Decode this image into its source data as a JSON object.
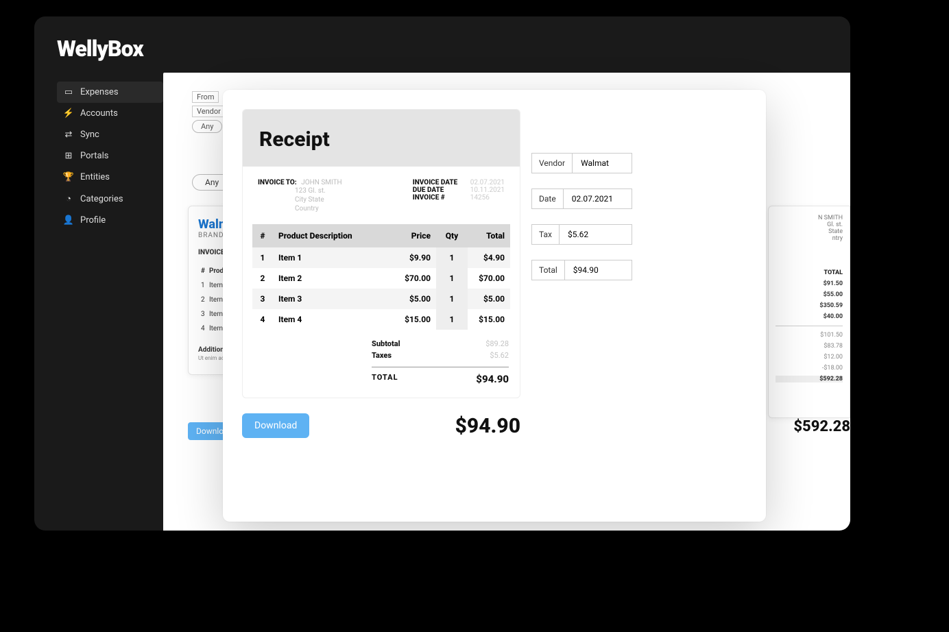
{
  "brand": "WellyBox",
  "sidebar": {
    "items": [
      {
        "label": "Expenses",
        "icon": "receipt-icon"
      },
      {
        "label": "Accounts",
        "icon": "plug-icon"
      },
      {
        "label": "Sync",
        "icon": "arrows-icon"
      },
      {
        "label": "Portals",
        "icon": "sitemap-icon"
      },
      {
        "label": "Entities",
        "icon": "trophy-icon"
      },
      {
        "label": "Categories",
        "icon": "pie-icon"
      },
      {
        "label": "Profile",
        "icon": "user-icon"
      }
    ],
    "active": 0
  },
  "filters": {
    "from_label": "From",
    "vendor_label": "Vendor",
    "any_chip": "Any"
  },
  "bg_left": {
    "brand": "Walm",
    "tag": "BRANDIN",
    "inv_to": "INVOICE TO",
    "hash": "#",
    "prod": "Prod",
    "rows": [
      {
        "n": "1",
        "v": "Item"
      },
      {
        "n": "2",
        "v": "Item"
      },
      {
        "n": "3",
        "v": "Item"
      },
      {
        "n": "4",
        "v": "Item"
      }
    ],
    "addl": "Additional",
    "lorem": "Ut enim ad mi ullamco labori consequat.",
    "download": "Download"
  },
  "bg_right": {
    "name": "N SMITH",
    "addr1": "Gl. st.",
    "addr2": "State",
    "addr3": "ntry",
    "total_label": "TOTAL",
    "values": [
      "$91.50",
      "$55.00",
      "$350.59",
      "$40.00"
    ],
    "subvalues": [
      "$101.50",
      "$83.78",
      "$12.00",
      "-$18.00"
    ],
    "grand": "$592.28",
    "big_total": "$592.28"
  },
  "receipt": {
    "title": "Receipt",
    "invoice_to_label": "INVOICE TO:",
    "invoice_to_name": "JOHN SMITH",
    "addr1": "123 Gl. st.",
    "addr2": "City    State",
    "addr3": "Country",
    "invoice_date_label": "INVOICE DATE",
    "invoice_date": "02.07.2021",
    "due_date_label": "DUE DATE",
    "due_date": "10.11.2021",
    "invoice_no_label": "INVOICE #",
    "invoice_no": "14256",
    "col_hash": "#",
    "col_desc": "Product Description",
    "col_price": "Price",
    "col_qty": "Qty",
    "col_total": "Total",
    "items": [
      {
        "n": "1",
        "desc": "Item 1",
        "price": "$9.90",
        "qty": "1",
        "total": "$4.90"
      },
      {
        "n": "2",
        "desc": "Item 2",
        "price": "$70.00",
        "qty": "1",
        "total": "$70.00"
      },
      {
        "n": "3",
        "desc": "Item 3",
        "price": "$5.00",
        "qty": "1",
        "total": "$5.00"
      },
      {
        "n": "4",
        "desc": "Item 4",
        "price": "$15.00",
        "qty": "1",
        "total": "$15.00"
      }
    ],
    "subtotal_label": "Subtotal",
    "subtotal": "$89.28",
    "taxes_label": "Taxes",
    "taxes": "$5.62",
    "total_label": "TOTAL",
    "total": "$94.90",
    "download": "Download",
    "grand_total": "$94.90"
  },
  "fields": {
    "vendor_label": "Vendor",
    "vendor": "Walmat",
    "date_label": "Date",
    "date": "02.07.2021",
    "tax_label": "Tax",
    "tax": "$5.62",
    "total_label": "Total",
    "total": "$94.90"
  }
}
